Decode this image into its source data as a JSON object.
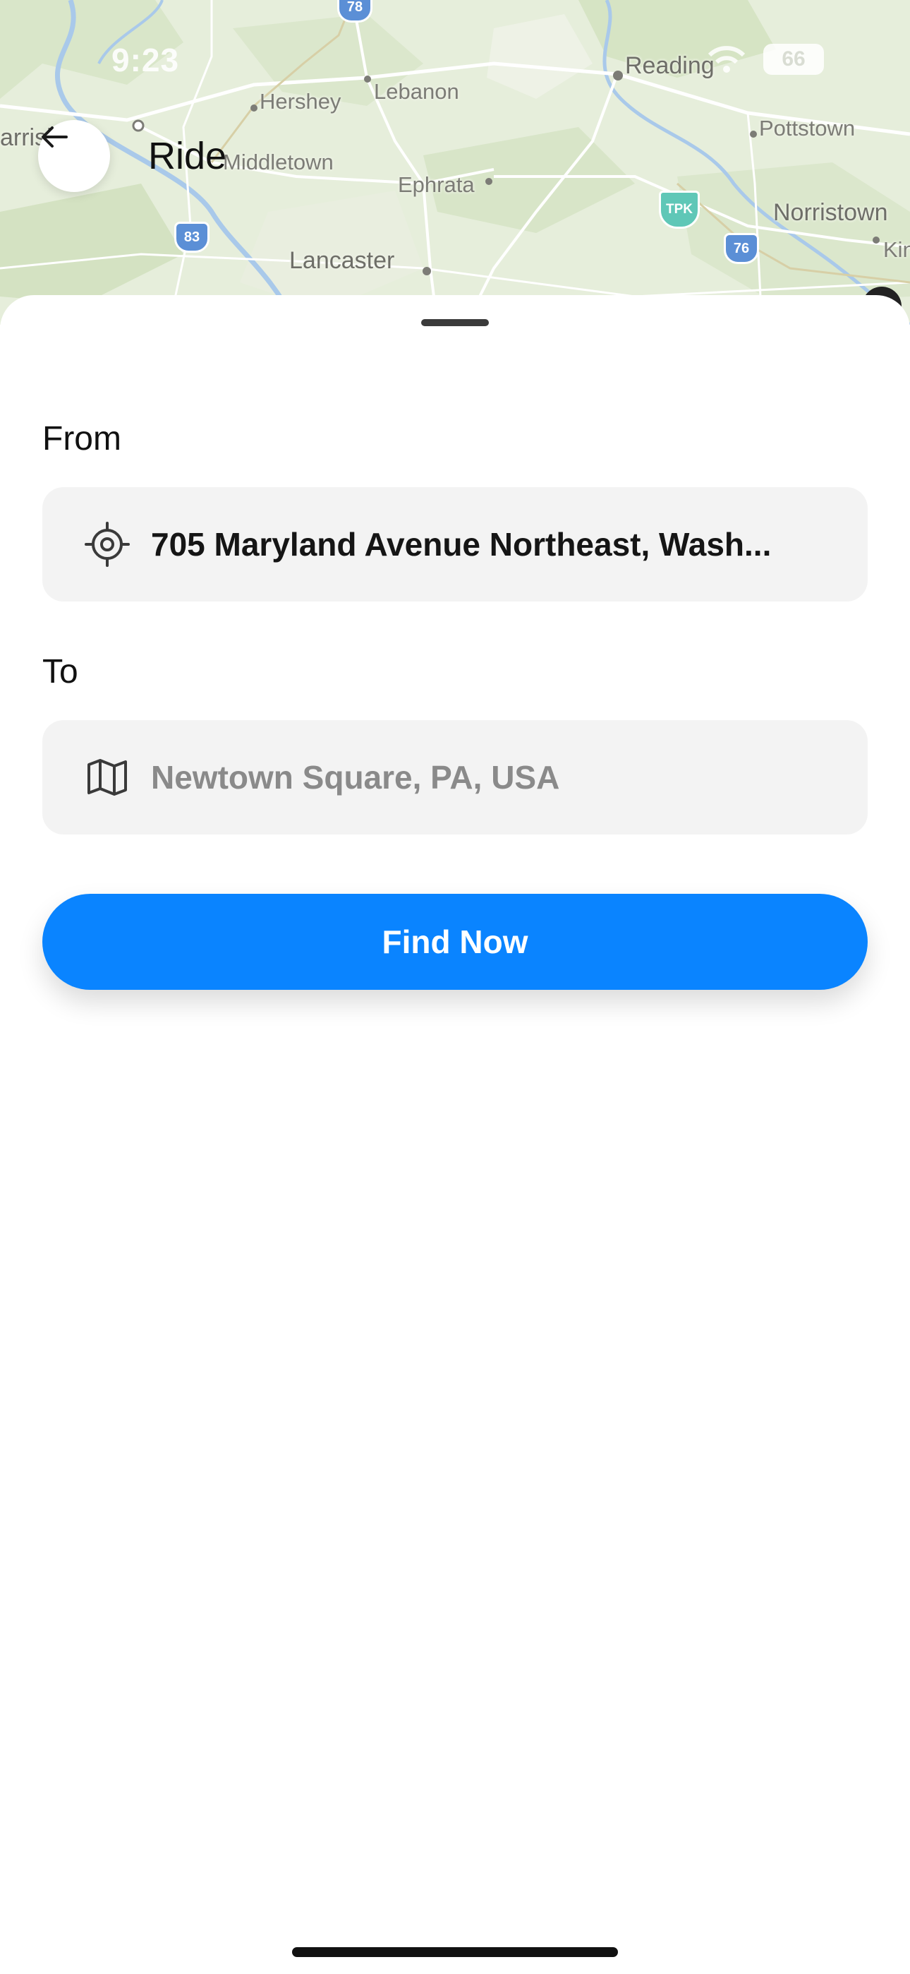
{
  "status_bar": {
    "time": "9:23",
    "battery": "66"
  },
  "map": {
    "labels": {
      "harrisburg": "arrisburg",
      "hershey": "Hershey",
      "lebanon": "Lebanon",
      "reading": "Reading",
      "pottstown": "Pottstown",
      "middletown": "Middletown",
      "ephrata": "Ephrata",
      "norristown": "Norristown",
      "lancaster": "Lancaster",
      "king": "Kin"
    },
    "shields": {
      "i78": "78",
      "i83": "83",
      "i76": "76",
      "tpk": "TPK"
    }
  },
  "header": {
    "back_icon": "arrow-left-icon",
    "title": "Ride"
  },
  "form": {
    "from_label": "From",
    "from_icon": "crosshair-location-icon",
    "from_value": "705 Maryland Avenue Northeast, Wash...",
    "to_label": "To",
    "to_icon": "map-icon",
    "to_placeholder": "Newtown Square, PA, USA",
    "submit_label": "Find Now"
  },
  "colors": {
    "primary": "#0a84ff",
    "field_bg": "#f3f3f3",
    "map_bg": "#e6eedb"
  }
}
